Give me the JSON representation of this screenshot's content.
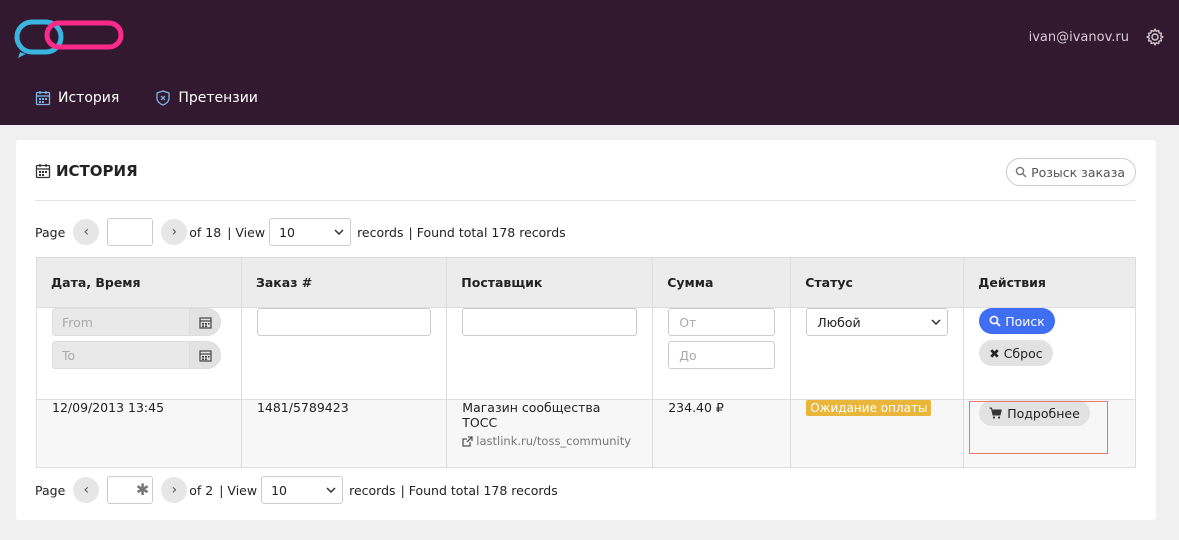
{
  "header": {
    "user_email": "ivan@ivanov.ru",
    "nav": [
      {
        "label": "История",
        "icon": "calendar-icon"
      },
      {
        "label": "Претензии",
        "icon": "shield-icon"
      }
    ]
  },
  "card": {
    "title": "ИСТОРИЯ",
    "search_order_label": "Розыск заказа"
  },
  "pager_top": {
    "page_label": "Page",
    "page_value": "",
    "of_label": "of 18",
    "view_label": "| View",
    "view_value": "10",
    "records_label": "records",
    "found_label": "| Found total 178 records"
  },
  "pager_bottom": {
    "page_label": "Page",
    "page_value": "",
    "of_label": "of 2",
    "view_label": "| View",
    "view_value": "10",
    "records_label": "records",
    "found_label": "| Found total 178 records"
  },
  "table": {
    "columns": [
      "Дата, Время",
      "Заказ #",
      "Поставщик",
      "Сумма",
      "Статус",
      "Действия"
    ],
    "filters": {
      "date_from_placeholder": "From",
      "date_to_placeholder": "To",
      "sum_from_placeholder": "От",
      "sum_to_placeholder": "До",
      "status_value": "Любой",
      "search_button": "Поиск",
      "reset_button": "Сброс"
    },
    "rows": [
      {
        "datetime": "12/09/2013 13:45",
        "order": "1481/5789423",
        "supplier": "Магазин сообщества ТОСС",
        "supplier_link": "lastlink.ru/toss_community",
        "sum": "234.40 ₽",
        "status": "Ожидание оплаты",
        "action": "Подробнее"
      }
    ]
  },
  "colors": {
    "topbar": "#33192f",
    "primary": "#3f6ef3",
    "status_pending": "#e9b53a",
    "logo_blue": "#3ab4e0",
    "logo_pink": "#ff2a8a",
    "highlight": "#e8786f"
  }
}
